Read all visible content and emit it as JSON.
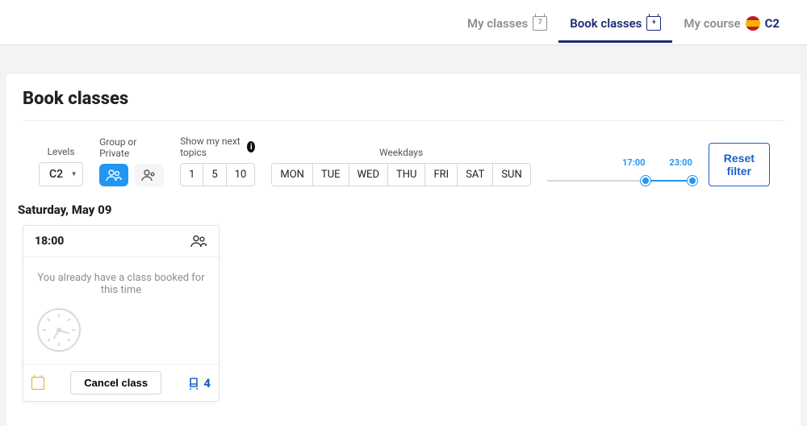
{
  "nav": {
    "my_classes": "My classes",
    "my_classes_badge": "7",
    "book_classes": "Book classes",
    "book_classes_badge": "+",
    "my_course": "My course",
    "course_level": "C2"
  },
  "page": {
    "title": "Book classes"
  },
  "filters": {
    "levels_label": "Levels",
    "levels_value": "C2",
    "group_private_label": "Group or Private",
    "next_topics_label": "Show my next topics",
    "next_topics_options": {
      "a": "1",
      "b": "5",
      "c": "10"
    },
    "weekdays_label": "Weekdays",
    "weekdays": {
      "mon": "MON",
      "tue": "TUE",
      "wed": "WED",
      "thu": "THU",
      "fri": "FRI",
      "sat": "SAT",
      "sun": "SUN"
    },
    "time_from": "17:00",
    "time_to": "23:00",
    "reset_label": "Reset filter"
  },
  "results": {
    "date": "Saturday, May 09",
    "card": {
      "time": "18:00",
      "message": "You already have a class booked for this time",
      "cancel_label": "Cancel class",
      "seats": "4"
    }
  }
}
